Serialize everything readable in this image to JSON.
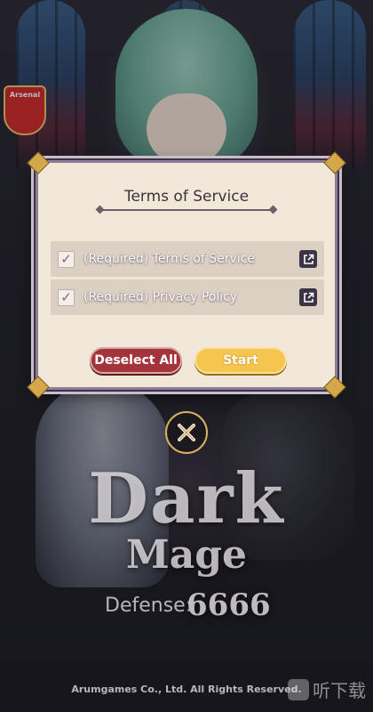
{
  "colors": {
    "deselect_button": "#a3343c",
    "start_button": "#f6c54d",
    "dialog_bg": "#f1e8da",
    "row_bg": "#dbd0c2"
  },
  "badge": {
    "text": "Arsenal"
  },
  "dialog": {
    "title": "Terms of Service",
    "items": [
      {
        "label": "(Required) Terms of Service",
        "checked": true,
        "icon": "external-link-icon"
      },
      {
        "label": "(Required) Privacy Policy",
        "checked": true,
        "icon": "external-link-icon"
      }
    ],
    "deselect_label": "Deselect All",
    "start_label": "Start"
  },
  "close_icon": "close-x-icon",
  "logo": {
    "line1": "Dark",
    "line2": "Mage",
    "defense": "Defense:",
    "number": "6666"
  },
  "footer": {
    "copyright": "Arumgames Co., Ltd. All Rights Reserved.",
    "watermark": "听下载"
  }
}
